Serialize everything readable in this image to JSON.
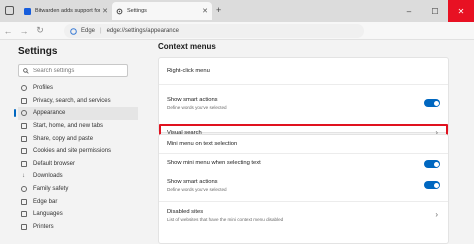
{
  "tabs": [
    {
      "title": "Bitwarden adds support for Sim",
      "active": false
    },
    {
      "title": "Settings",
      "active": true
    }
  ],
  "address_bar": {
    "origin": "Edge",
    "url": "edge://settings/appearance"
  },
  "sidebar": {
    "title": "Settings",
    "search_placeholder": "Search settings",
    "items": [
      {
        "label": "Profiles",
        "icon": "person-icon"
      },
      {
        "label": "Privacy, search, and services",
        "icon": "lock-icon"
      },
      {
        "label": "Appearance",
        "icon": "appearance-icon",
        "active": true
      },
      {
        "label": "Start, home, and new tabs",
        "icon": "home-icon"
      },
      {
        "label": "Share, copy and paste",
        "icon": "share-icon"
      },
      {
        "label": "Cookies and site permissions",
        "icon": "cookie-icon"
      },
      {
        "label": "Default browser",
        "icon": "browser-icon"
      },
      {
        "label": "Downloads",
        "icon": "download-icon"
      },
      {
        "label": "Family safety",
        "icon": "family-icon"
      },
      {
        "label": "Edge bar",
        "icon": "edge-bar-icon"
      },
      {
        "label": "Languages",
        "icon": "language-icon"
      },
      {
        "label": "Printers",
        "icon": "printer-icon"
      }
    ]
  },
  "main": {
    "section_title": "Context menus",
    "right_click": {
      "heading": "Right-click menu",
      "show_smart_actions": {
        "title": "Show smart actions",
        "subtitle": "Define words you've selected",
        "enabled": true
      },
      "visual_search": {
        "title": "Visual search"
      }
    },
    "mini_menu": {
      "heading": "Mini menu on text selection",
      "show_mini_menu": {
        "title": "Show mini menu when selecting text",
        "enabled": true
      },
      "show_smart_actions": {
        "title": "Show smart actions",
        "subtitle": "Define words you've selected",
        "enabled": true
      },
      "disabled_sites": {
        "title": "Disabled sites",
        "subtitle": "List of websites that have the mini context menu disabled"
      }
    }
  },
  "colors": {
    "accent": "#0067c0",
    "highlight": "#e0121f",
    "close": "#e81123"
  }
}
